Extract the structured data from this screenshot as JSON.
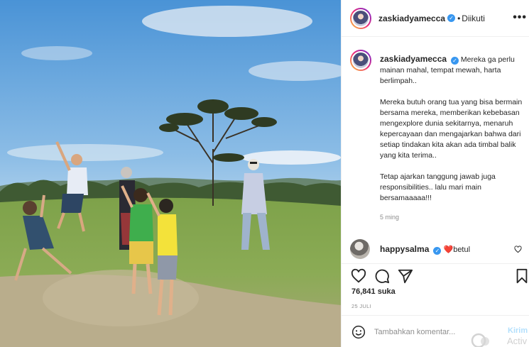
{
  "post": {
    "username": "zaskiadyamecca",
    "verified": true,
    "separator": "•",
    "follow_status": "Diikuti",
    "more_label": "•••"
  },
  "caption": {
    "username": "zaskiadyamecca",
    "paragraphs": [
      "Mereka ga perlu mainan mahal, tempat mewah, harta berlimpah..",
      "Mereka butuh orang tua yang bisa bermain bersama mereka, memberikan kebebasan mengexplore dunia sekitarnya, menaruh kepercayaan dan mengajarkan bahwa dari setiap tindakan kita akan ada timbal balik yang kita terima..",
      "Tetap ajarkan tanggung jawab juga responsibilities.. lalu mari main bersamaaaaa!!!"
    ],
    "time": "5 ming"
  },
  "comment": {
    "username": "happysalma",
    "verified": true,
    "text": "❤️betul"
  },
  "actions": {
    "icons": [
      "heart-icon",
      "comment-icon",
      "share-icon",
      "bookmark-icon"
    ],
    "likes": "76,841 suka",
    "date": "25 JULI"
  },
  "comment_box": {
    "placeholder": "Tambahkan komentar...",
    "post_label": "Kirim"
  },
  "overlay": {
    "watermark_text": "Activ"
  },
  "colors": {
    "accent": "#3897f0",
    "text": "#262626",
    "muted": "#8e8e8e",
    "post_disabled": "#b2dffc",
    "border": "#efefef"
  }
}
